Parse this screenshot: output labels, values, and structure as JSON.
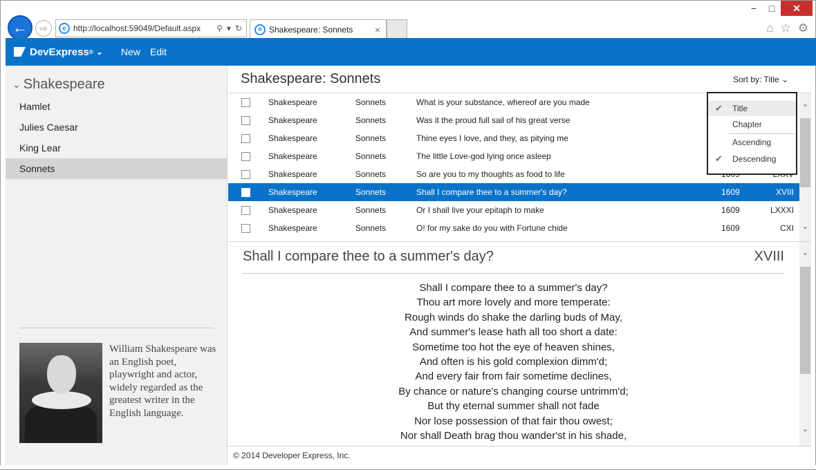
{
  "browser": {
    "url": "http://localhost:59049/Default.aspx",
    "tab_title": "Shakespeare: Sonnets",
    "back_glyph": "←",
    "forward_glyph": "⇨",
    "ie_glyph": "e",
    "search_glyph": "⚲",
    "dropdown_glyph": "▾",
    "refresh_glyph": "↻",
    "close_glyph": "×",
    "minimize_glyph": "−",
    "maximize_glyph": "□",
    "window_close_glyph": "✕",
    "home_glyph": "⌂",
    "favorites_glyph": "☆",
    "settings_glyph": "⚙"
  },
  "header": {
    "brand": "DevExpress",
    "brand_mark": "®",
    "brand_chevron": "⌄",
    "menu": [
      "New",
      "Edit"
    ],
    "accent_color": "#0b72c9"
  },
  "sidebar": {
    "chevron": "⌄",
    "title": "Shakespeare",
    "items": [
      {
        "label": "Hamlet"
      },
      {
        "label": "Julies Caesar"
      },
      {
        "label": "King Lear"
      },
      {
        "label": "Sonnets",
        "selected": true
      }
    ],
    "bio": "William Shakespeare was an English poet, playwright and actor, widely regarded as the greatest writer in the English language."
  },
  "main": {
    "title": "Shakespeare: Sonnets",
    "sort_label": "Sort by: Title",
    "sort_chevron": "⌄"
  },
  "sort_menu": {
    "check_glyph": "✔",
    "items": [
      {
        "label": "Title",
        "checked": true,
        "highlighted": true
      },
      {
        "label": "Chapter",
        "checked": false
      },
      {
        "label": "Ascending",
        "checked": false
      },
      {
        "label": "Descending",
        "checked": true
      }
    ]
  },
  "grid": {
    "rows": [
      {
        "author": "Shakespeare",
        "book": "Sonnets",
        "title": "What is your substance, whereof are you made",
        "year": "",
        "number": ""
      },
      {
        "author": "Shakespeare",
        "book": "Sonnets",
        "title": "Was it the proud full sail of his great verse",
        "year": "",
        "number": ""
      },
      {
        "author": "Shakespeare",
        "book": "Sonnets",
        "title": "Thine eyes I love, and they, as pitying me",
        "year": "",
        "number": ""
      },
      {
        "author": "Shakespeare",
        "book": "Sonnets",
        "title": "The little Love-god lying once asleep",
        "year": "",
        "number": ""
      },
      {
        "author": "Shakespeare",
        "book": "Sonnets",
        "title": "So are you to my thoughts as food to life",
        "year": "1609",
        "number": "LXXV"
      },
      {
        "author": "Shakespeare",
        "book": "Sonnets",
        "title": "Shall I compare thee to a summer's day?",
        "year": "1609",
        "number": "XVIII",
        "selected": true
      },
      {
        "author": "Shakespeare",
        "book": "Sonnets",
        "title": "Or I shall live your epitaph to make",
        "year": "1609",
        "number": "LXXXI"
      },
      {
        "author": "Shakespeare",
        "book": "Sonnets",
        "title": "O! for my sake do you with Fortune chide",
        "year": "1609",
        "number": "CXI"
      }
    ],
    "scroll_up": "⌃",
    "scroll_down": "⌄"
  },
  "detail": {
    "title": "Shall I compare thee to a summer's day?",
    "number": "XVIII",
    "lines": [
      "Shall I compare thee to a summer's day?",
      "Thou art more lovely and more temperate:",
      "Rough winds do shake the darling buds of May,",
      "And summer's lease hath all too short a date:",
      "Sometime too hot the eye of heaven shines,",
      "And often is his gold complexion dimm'd;",
      "And every fair from fair sometime declines,",
      "By chance or nature's changing course untrimm'd;",
      "But thy eternal summer shall not fade",
      "Nor lose possession of that fair thou owest;",
      "Nor shall Death brag thou wander'st in his shade,"
    ]
  },
  "footer": {
    "text": "© 2014 Developer Express, Inc."
  }
}
